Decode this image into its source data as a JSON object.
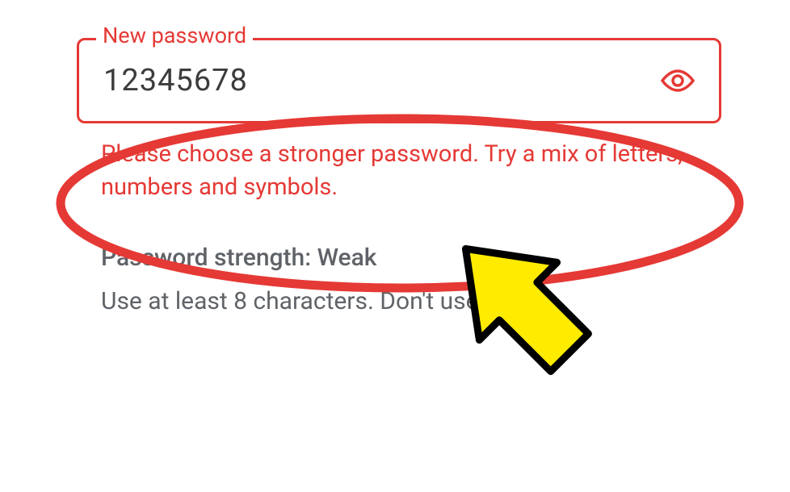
{
  "field": {
    "label": "New password",
    "value": "12345678"
  },
  "error": {
    "message": "Please choose a stronger password. Try a mix of letters, numbers and symbols."
  },
  "strength": {
    "label": "Password strength: Weak"
  },
  "hint": {
    "text": "Use at least 8 characters. Don't use a"
  },
  "colors": {
    "error": "#e53935",
    "text_muted": "#5f6368",
    "text_dark": "#3c3c3c",
    "arrow_fill": "#ffeb00",
    "arrow_stroke": "#000000"
  }
}
